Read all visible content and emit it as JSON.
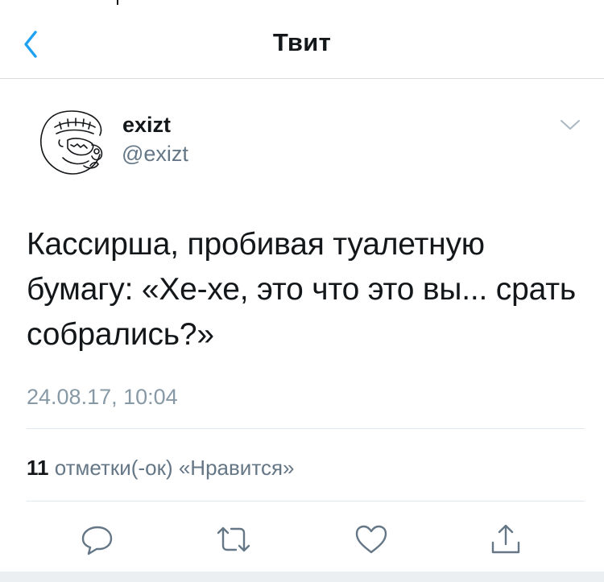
{
  "nav": {
    "back_icon": "chevron-left-icon",
    "title": "Твит"
  },
  "author": {
    "name": "exizt",
    "handle": "@exizt",
    "avatar": "sketch-avatar"
  },
  "tweet": {
    "text": "Кассирша, пробивая туалетную бумагу: «Хе-хе, это что это вы... срать собрались?»",
    "timestamp": "24.08.17, 10:04"
  },
  "stats": {
    "likes_count": "11",
    "likes_label": "отметки(-ок) «Нравится»"
  },
  "actions": {
    "reply_icon": "reply-icon",
    "retweet_icon": "retweet-icon",
    "like_icon": "heart-icon",
    "share_icon": "share-icon"
  },
  "colors": {
    "accent": "#1da1f2",
    "text": "#14171a",
    "secondary": "#657786",
    "timestamp": "#8899a6",
    "icons": "#657786",
    "divider": "#e1e8ed"
  }
}
